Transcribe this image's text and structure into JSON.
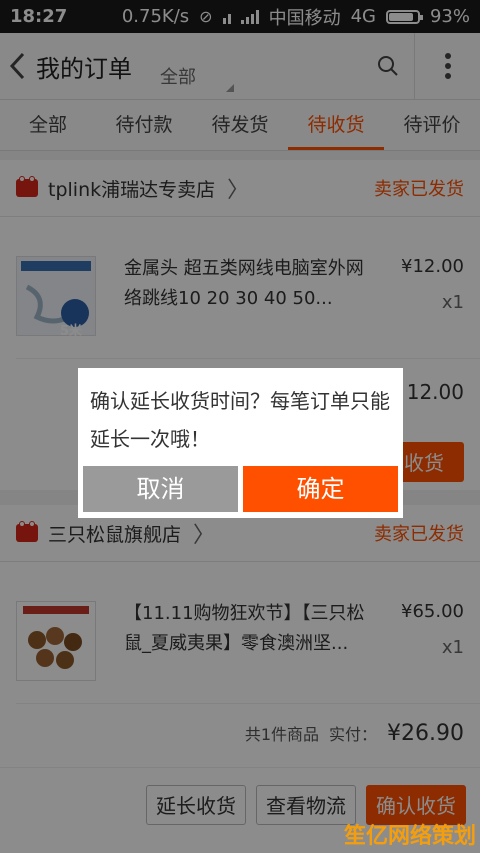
{
  "status": {
    "time": "18:27",
    "speed": "0.75K/s",
    "carrier": "中国移动",
    "network": "4G",
    "battery": "93%",
    "battery_level": 0.93
  },
  "topbar": {
    "title": "我的订单",
    "filter": "全部"
  },
  "tabs": [
    "全部",
    "待付款",
    "待发货",
    "待收货",
    "待评价"
  ],
  "active_tab": "待收货",
  "orders": [
    {
      "shop": "tplink浦瑞达专卖店",
      "status": "卖家已发货",
      "product": "金属头 超五类网线电脑室外网络跳线10 20 30 40 50...",
      "price": "¥12.00",
      "qty": "x1",
      "total_partial": "12.00",
      "action_partial": "认收货",
      "thumb_text": "5米"
    },
    {
      "shop": "三只松鼠旗舰店",
      "status": "卖家已发货",
      "product": "【11.11购物狂欢节】【三只松鼠_夏威夷果】零食澳洲坚...",
      "price": "¥65.00",
      "qty": "x1",
      "summary_count": "共1件商品",
      "summary_paid": "实付：",
      "summary_amount": "¥26.90",
      "actions": [
        "延长收货",
        "查看物流",
        "确认收货"
      ]
    }
  ],
  "dialog": {
    "message": "确认延长收货时间？每笔订单只能延长一次哦！",
    "cancel": "取消",
    "confirm": "确定"
  },
  "watermark": "笙亿网络策划",
  "colors": {
    "accent": "#ff5000",
    "cancel_gray": "#9a9a9a",
    "status_bar": "#1a1a1a"
  }
}
